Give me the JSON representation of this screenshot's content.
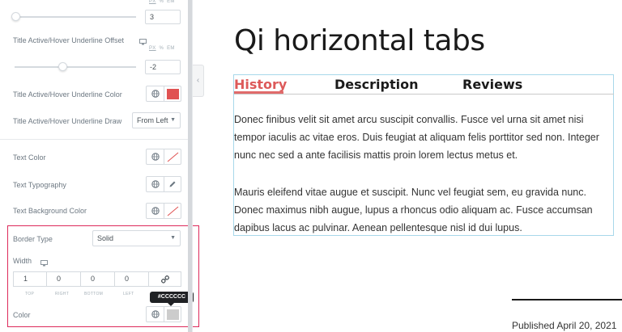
{
  "panel": {
    "top_slider": {
      "value": "3",
      "units": [
        "PX",
        "%",
        "EM"
      ],
      "active_unit": "PX"
    },
    "underline_offset": {
      "label": "Title Active/Hover Underline Offset",
      "value": "-2",
      "units": [
        "PX",
        "%",
        "EM"
      ],
      "active_unit": "PX",
      "slider_level_fraction": 0.45
    },
    "underline_color": {
      "label": "Title Active/Hover Underline Color",
      "swatch": "#e05252"
    },
    "underline_draw": {
      "label": "Title Active/Hover Underline Draw",
      "value": "From Left"
    },
    "text_color": {
      "label": "Text Color"
    },
    "text_typography": {
      "label": "Text Typography"
    },
    "text_bg_color": {
      "label": "Text Background Color"
    },
    "border": {
      "type_label": "Border Type",
      "type_value": "Solid",
      "width_label": "Width",
      "width_values": [
        "1",
        "0",
        "0",
        "0"
      ],
      "width_sides": [
        "TOP",
        "RIGHT",
        "BOTTOM",
        "LEFT"
      ],
      "color_label": "Color",
      "color_tooltip": "#CCCCCC",
      "color_swatch": "#cccccc"
    },
    "highlight_color": "#dd2a5b"
  },
  "preview": {
    "title": "Qi horizontal tabs",
    "tabs": [
      {
        "label": "History",
        "active": true
      },
      {
        "label": "Description",
        "active": false
      },
      {
        "label": "Reviews",
        "active": false
      }
    ],
    "active_color": "#dd5a5a",
    "paragraphs": [
      "Donec finibus velit sit amet arcu suscipit convallis. Fusce vel urna sit amet nisi tempor iaculis ac vitae eros. Duis feugiat at aliquam felis porttitor sed non. Integer nunc nec sed a ante facilisis mattis proin lorem lectus metus et.",
      "Mauris eleifend vitae augue et suscipit. Nunc vel feugiat sem, eu gravida nunc. Donec maximus nibh augue, lupus a rhoncus odio aliquam ac. Fusce accumsan dapibus lacus ac pulvinar. Aenean pellentesque nisl id dui lupus."
    ],
    "published": "Published April 20, 2021"
  }
}
